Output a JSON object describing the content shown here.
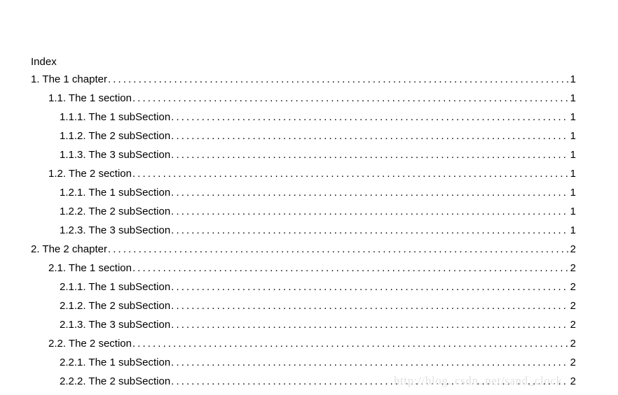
{
  "document": {
    "title": "Index",
    "watermark": "http://blog. csdn. net/sand_clock",
    "background_color": "#ffffff",
    "text_color": "#000000",
    "watermark_color": "#e2e2e2",
    "leader_char": "."
  },
  "toc": {
    "entries": [
      {
        "label": "1. The 1 chapter",
        "page": "1",
        "level": 1
      },
      {
        "label": "1.1. The 1 section",
        "page": "1",
        "level": 2
      },
      {
        "label": "1.1.1. The 1 subSection",
        "page": "1",
        "level": 3
      },
      {
        "label": "1.1.2. The 2 subSection",
        "page": "1",
        "level": 3
      },
      {
        "label": "1.1.3. The 3 subSection",
        "page": "1",
        "level": 3
      },
      {
        "label": "1.2. The 2 section",
        "page": "1",
        "level": 2
      },
      {
        "label": "1.2.1. The 1 subSection",
        "page": "1",
        "level": 3
      },
      {
        "label": "1.2.2. The 2 subSection",
        "page": "1",
        "level": 3
      },
      {
        "label": "1.2.3. The 3 subSection",
        "page": "1",
        "level": 3
      },
      {
        "label": "2. The 2 chapter",
        "page": "2",
        "level": 1
      },
      {
        "label": "2.1. The 1 section",
        "page": "2",
        "level": 2
      },
      {
        "label": "2.1.1. The 1 subSection",
        "page": "2",
        "level": 3
      },
      {
        "label": "2.1.2. The 2 subSection",
        "page": "2",
        "level": 3
      },
      {
        "label": "2.1.3. The 3 subSection",
        "page": "2",
        "level": 3
      },
      {
        "label": "2.2. The 2 section",
        "page": "2",
        "level": 2
      },
      {
        "label": "2.2.1. The 1 subSection",
        "page": "2",
        "level": 3
      },
      {
        "label": "2.2.2. The 2 subSection",
        "page": "2",
        "level": 3
      }
    ]
  }
}
